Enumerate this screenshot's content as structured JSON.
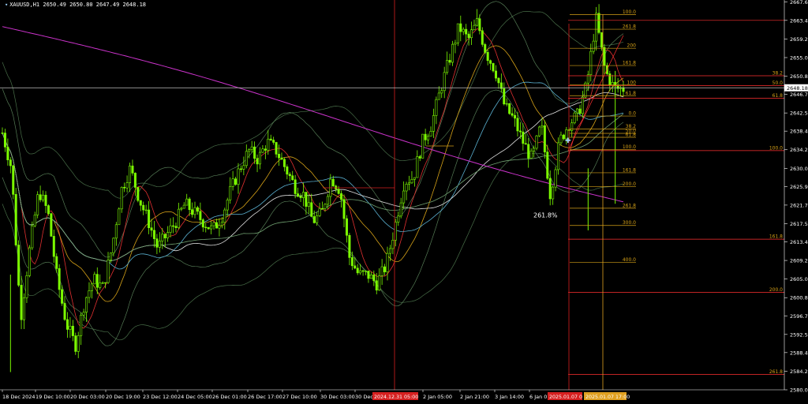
{
  "window": {
    "symbol_info": "XAUUSD,H1  2650.49 2650.80 2647.49 2648.18"
  },
  "colors": {
    "background": "#000000",
    "candle": "#7CFC00",
    "axis_text": "#ffffff",
    "fib_level": "#d4a017",
    "fib_red": "#ff3030",
    "price_line": "#c0c0c0",
    "ma_magenta": "#cc33cc"
  },
  "price_axis": {
    "min": 2580.0,
    "max": 2668.0,
    "ticks": [
      {
        "value": 2667.6,
        "label": "2667.60"
      },
      {
        "value": 2663.4,
        "label": "2663.40"
      },
      {
        "value": 2659.2,
        "label": "2659.20"
      },
      {
        "value": 2655.0,
        "label": "2655.00"
      },
      {
        "value": 2650.8,
        "label": "2650.80"
      },
      {
        "value": 2646.7,
        "label": "2646.70"
      },
      {
        "value": 2642.5,
        "label": "2642.50"
      },
      {
        "value": 2638.4,
        "label": "2638.40"
      },
      {
        "value": 2634.2,
        "label": "2634.20"
      },
      {
        "value": 2630.0,
        "label": "2630.00"
      },
      {
        "value": 2625.9,
        "label": "2625.90"
      },
      {
        "value": 2621.7,
        "label": "2621.70"
      },
      {
        "value": 2617.5,
        "label": "2617.50"
      },
      {
        "value": 2613.4,
        "label": "2613.40"
      },
      {
        "value": 2609.2,
        "label": "2609.20"
      },
      {
        "value": 2605.0,
        "label": "2605.00"
      },
      {
        "value": 2600.8,
        "label": "2600.80"
      },
      {
        "value": 2596.7,
        "label": "2596.70"
      },
      {
        "value": 2592.5,
        "label": "2592.50"
      },
      {
        "value": 2588.4,
        "label": "2588.40"
      },
      {
        "value": 2584.2,
        "label": "2584.20"
      },
      {
        "value": 2580.0,
        "label": "2580.00"
      }
    ],
    "current_price": {
      "value": 2648.18,
      "label": "2648.18"
    }
  },
  "time_axis": {
    "labels": [
      "18 Dec 2024",
      "19 Dec 10:00",
      "20 Dec 03:00",
      "20 Dec 19:00",
      "23 Dec 12:00",
      "24 Dec 05:00",
      "26 Dec 01:00",
      "26 Dec 17:00",
      "27 Dec 10:00",
      "30 Dec 03:00",
      "30 Dec 1",
      "2 Jan 05:00",
      "2 Jan 21:00",
      "3 Jan 14:00",
      "6 Jan 07"
    ],
    "highlight_labels": [
      {
        "label": "2024.12.31 05:00",
        "bg": "#d62020"
      },
      {
        "label": "2025.01.07 0",
        "bg": "#d62020"
      },
      {
        "label": "2025.01.07 17:00",
        "bg": "#e0a020"
      }
    ]
  },
  "chart_data": {
    "type": "candlestick",
    "ylim": [
      2580.0,
      2668.0
    ],
    "close_path": [
      2638,
      2630,
      2596,
      2612,
      2625,
      2620,
      2605,
      2595,
      2590,
      2600,
      2605,
      2603,
      2612,
      2625,
      2630,
      2623,
      2618,
      2612,
      2615,
      2618,
      2622,
      2620,
      2618,
      2616,
      2619,
      2625,
      2630,
      2634,
      2632,
      2636,
      2634,
      2630,
      2626,
      2624,
      2618,
      2620,
      2628,
      2625,
      2610,
      2606,
      2606,
      2604,
      2608,
      2617,
      2627,
      2628,
      2636,
      2640,
      2648,
      2655,
      2662,
      2659,
      2663,
      2656,
      2652,
      2644,
      2641,
      2636,
      2632,
      2640,
      2624,
      2636,
      2640,
      2642,
      2649,
      2664,
      2652,
      2648,
      2648
    ],
    "fib_labels_right": [
      {
        "value": 2650.9,
        "label": "38.2"
      },
      {
        "value": 2648.7,
        "label": "50.0"
      },
      {
        "value": 2645.8,
        "label": "61.8"
      },
      {
        "value": 2634.0,
        "label": "100.0"
      },
      {
        "value": 2614.0,
        "label": "161.8"
      },
      {
        "value": 2602.0,
        "label": "200.0"
      },
      {
        "value": 2583.5,
        "label": "261.8"
      }
    ],
    "fib_labels_inner": [
      {
        "value": 2664.7,
        "label": "100.0"
      },
      {
        "value": 2661.4,
        "label": "261.8"
      },
      {
        "value": 2657.1,
        "label": "200"
      },
      {
        "value": 2653.2,
        "label": "161.8"
      },
      {
        "value": 2648.8,
        "label": "100"
      },
      {
        "value": 2646.4,
        "label": "61.8"
      },
      {
        "value": 2641.8,
        "label": "0.0"
      },
      {
        "value": 2638.9,
        "label": "38.2"
      },
      {
        "value": 2637.9,
        "label": "50.0"
      },
      {
        "value": 2637.0,
        "label": "61.8"
      },
      {
        "value": 2634.2,
        "label": "100.0"
      },
      {
        "value": 2629.0,
        "label": "161.8"
      },
      {
        "value": 2625.9,
        "label": "200.0"
      },
      {
        "value": 2621.0,
        "label": "261.8"
      },
      {
        "value": 2617.1,
        "label": "300.0"
      },
      {
        "value": 2608.8,
        "label": "400.0"
      }
    ],
    "annotation": {
      "value": 2619.5,
      "label": "261.8%"
    }
  }
}
